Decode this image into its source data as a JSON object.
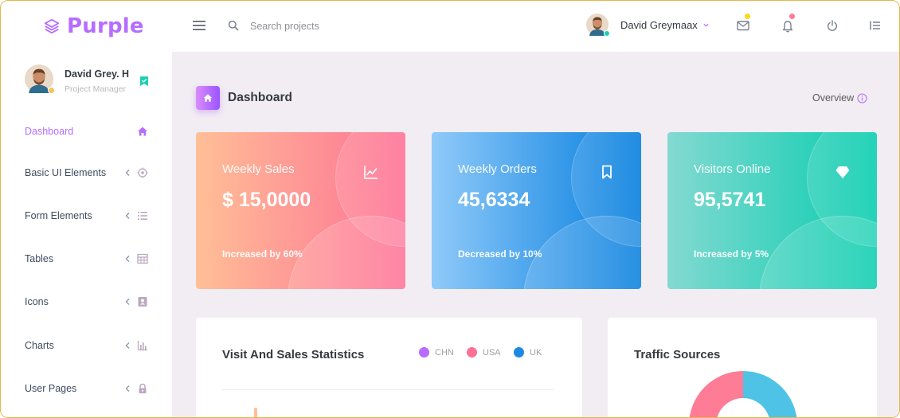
{
  "brand": {
    "name": "Purple",
    "color": "#b66dff"
  },
  "navbar": {
    "search_placeholder": "Search projects",
    "user_name": "David Greymaax",
    "icons": [
      "menu-icon",
      "search-icon",
      "mail-icon",
      "bell-icon",
      "power-icon",
      "list-icon"
    ]
  },
  "sidebar": {
    "profile": {
      "name": "David Grey. H",
      "role": "Project Manager"
    },
    "items": [
      {
        "label": "Dashboard",
        "icon": "home-icon",
        "active": true
      },
      {
        "label": "Basic UI Elements",
        "icon": "crosshairs-icon"
      },
      {
        "label": "Form Elements",
        "icon": "list-icon"
      },
      {
        "label": "Tables",
        "icon": "table-icon"
      },
      {
        "label": "Icons",
        "icon": "contacts-icon"
      },
      {
        "label": "Charts",
        "icon": "bar-chart-icon"
      },
      {
        "label": "User Pages",
        "icon": "lock-icon"
      }
    ]
  },
  "main": {
    "page_title": "Dashboard",
    "overview_label": "Overview",
    "cards": [
      {
        "title": "Weekly Sales",
        "value": "$ 15,0000",
        "sub": "Increased by 60%",
        "icon": "chart-line-icon"
      },
      {
        "title": "Weekly Orders",
        "value": "45,6334",
        "sub": "Decreased by 10%",
        "icon": "bookmark-icon"
      },
      {
        "title": "Visitors Online",
        "value": "95,5741",
        "sub": "Increased by 5%",
        "icon": "diamond-icon"
      }
    ],
    "stats_panel": {
      "title": "Visit And Sales Statistics",
      "legend": [
        {
          "label": "CHN",
          "color": "#b66dff"
        },
        {
          "label": "USA",
          "color": "#fe7096"
        },
        {
          "label": "UK",
          "color": "#1e88e5"
        }
      ]
    },
    "traffic_panel": {
      "title": "Traffic Sources"
    }
  }
}
